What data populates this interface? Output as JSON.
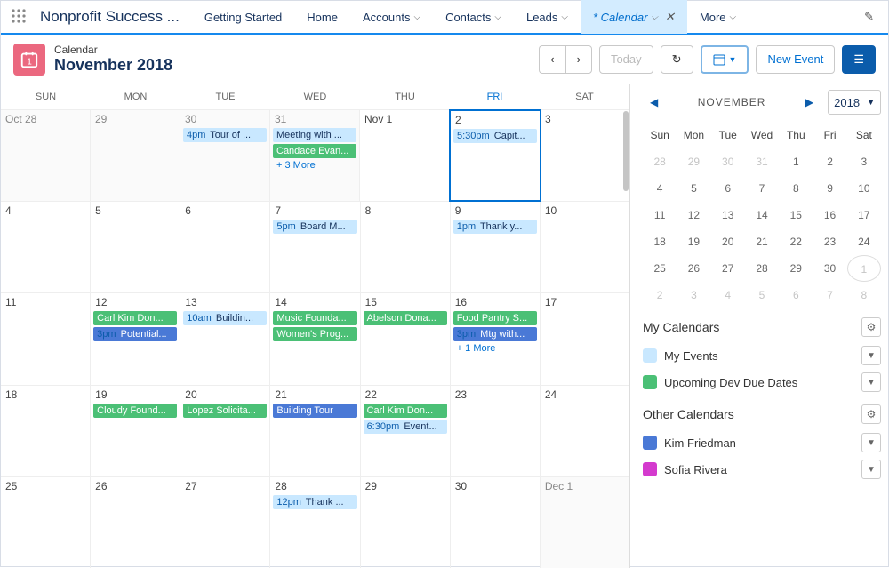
{
  "header": {
    "app_name": "Nonprofit Success ...",
    "tabs": [
      {
        "label": "Getting Started",
        "chev": false,
        "close": false
      },
      {
        "label": "Home",
        "chev": false,
        "close": false
      },
      {
        "label": "Accounts",
        "chev": true,
        "close": false
      },
      {
        "label": "Contacts",
        "chev": true,
        "close": false
      },
      {
        "label": "Leads",
        "chev": true,
        "close": false
      },
      {
        "label": "* Calendar",
        "chev": true,
        "close": true,
        "active": true
      },
      {
        "label": "More",
        "chev": true,
        "close": false
      }
    ]
  },
  "toolbar": {
    "subtitle": "Calendar",
    "title": "November 2018",
    "today": "Today",
    "new_event": "New Event"
  },
  "grid": {
    "dow": [
      "SUN",
      "MON",
      "TUE",
      "WED",
      "THU",
      "FRI",
      "SAT"
    ],
    "weeks": [
      [
        {
          "num": "Oct 28",
          "out": true,
          "events": []
        },
        {
          "num": "29",
          "out": true,
          "events": []
        },
        {
          "num": "30",
          "out": true,
          "events": [
            {
              "time": "4pm",
              "title": "Tour of ...",
              "cls": "lblue"
            }
          ]
        },
        {
          "num": "31",
          "out": true,
          "events": [
            {
              "title": "Meeting with ...",
              "cls": "lblue"
            },
            {
              "title": "Candace Evan...",
              "cls": "green"
            }
          ],
          "more": "+ 3 More"
        },
        {
          "num": "Nov 1",
          "events": []
        },
        {
          "num": "2",
          "selected": true,
          "events": [
            {
              "time": "5:30pm",
              "title": "Capit...",
              "cls": "lblue"
            }
          ]
        },
        {
          "num": "3",
          "events": []
        }
      ],
      [
        {
          "num": "4",
          "events": []
        },
        {
          "num": "5",
          "events": []
        },
        {
          "num": "6",
          "events": []
        },
        {
          "num": "7",
          "events": [
            {
              "time": "5pm",
              "title": "Board M...",
              "cls": "lblue"
            }
          ]
        },
        {
          "num": "8",
          "events": []
        },
        {
          "num": "9",
          "events": [
            {
              "time": "1pm",
              "title": "Thank y...",
              "cls": "lblue"
            }
          ]
        },
        {
          "num": "10",
          "events": []
        }
      ],
      [
        {
          "num": "11",
          "events": []
        },
        {
          "num": "12",
          "events": [
            {
              "title": "Carl Kim Don...",
              "cls": "green"
            },
            {
              "time": "3pm",
              "title": "Potential...",
              "cls": "nblue"
            }
          ]
        },
        {
          "num": "13",
          "events": [
            {
              "time": "10am",
              "title": "Buildin...",
              "cls": "lblue"
            }
          ]
        },
        {
          "num": "14",
          "events": [
            {
              "title": "Music Founda...",
              "cls": "green"
            },
            {
              "title": "Women's Prog...",
              "cls": "green"
            }
          ]
        },
        {
          "num": "15",
          "events": [
            {
              "title": "Abelson Dona...",
              "cls": "green"
            }
          ]
        },
        {
          "num": "16",
          "events": [
            {
              "title": "Food Pantry S...",
              "cls": "green"
            },
            {
              "time": "3pm",
              "title": "Mtg with...",
              "cls": "nblue"
            }
          ],
          "more": "+ 1 More"
        },
        {
          "num": "17",
          "events": []
        }
      ],
      [
        {
          "num": "18",
          "events": []
        },
        {
          "num": "19",
          "events": [
            {
              "title": "Cloudy Found...",
              "cls": "green"
            }
          ]
        },
        {
          "num": "20",
          "events": [
            {
              "title": "Lopez Solicita...",
              "cls": "green"
            }
          ]
        },
        {
          "num": "21",
          "events": [
            {
              "title": "Building Tour",
              "cls": "nblue"
            }
          ]
        },
        {
          "num": "22",
          "events": [
            {
              "title": "Carl Kim Don...",
              "cls": "green"
            },
            {
              "time": "6:30pm",
              "title": "Event...",
              "cls": "lblue"
            }
          ]
        },
        {
          "num": "23",
          "events": []
        },
        {
          "num": "24",
          "events": []
        }
      ],
      [
        {
          "num": "25",
          "events": []
        },
        {
          "num": "26",
          "events": []
        },
        {
          "num": "27",
          "events": []
        },
        {
          "num": "28",
          "events": [
            {
              "time": "12pm",
              "title": "Thank ...",
              "cls": "lblue"
            }
          ]
        },
        {
          "num": "29",
          "events": []
        },
        {
          "num": "30",
          "events": []
        },
        {
          "num": "Dec 1",
          "out": true,
          "events": []
        }
      ]
    ]
  },
  "mini": {
    "month": "NOVEMBER",
    "year": "2018",
    "dow": [
      "Sun",
      "Mon",
      "Tue",
      "Wed",
      "Thu",
      "Fri",
      "Sat"
    ],
    "rows": [
      [
        {
          "n": "28",
          "out": true
        },
        {
          "n": "29",
          "out": true
        },
        {
          "n": "30",
          "out": true
        },
        {
          "n": "31",
          "out": true
        },
        {
          "n": "1"
        },
        {
          "n": "2"
        },
        {
          "n": "3"
        }
      ],
      [
        {
          "n": "4"
        },
        {
          "n": "5"
        },
        {
          "n": "6"
        },
        {
          "n": "7"
        },
        {
          "n": "8"
        },
        {
          "n": "9"
        },
        {
          "n": "10"
        }
      ],
      [
        {
          "n": "11"
        },
        {
          "n": "12"
        },
        {
          "n": "13"
        },
        {
          "n": "14"
        },
        {
          "n": "15"
        },
        {
          "n": "16"
        },
        {
          "n": "17"
        }
      ],
      [
        {
          "n": "18"
        },
        {
          "n": "19"
        },
        {
          "n": "20"
        },
        {
          "n": "21"
        },
        {
          "n": "22"
        },
        {
          "n": "23"
        },
        {
          "n": "24"
        }
      ],
      [
        {
          "n": "25"
        },
        {
          "n": "26"
        },
        {
          "n": "27"
        },
        {
          "n": "28"
        },
        {
          "n": "29"
        },
        {
          "n": "30"
        },
        {
          "n": "1",
          "out": true,
          "cur": true
        }
      ],
      [
        {
          "n": "2",
          "out": true
        },
        {
          "n": "3",
          "out": true
        },
        {
          "n": "4",
          "out": true
        },
        {
          "n": "5",
          "out": true
        },
        {
          "n": "6",
          "out": true
        },
        {
          "n": "7",
          "out": true
        },
        {
          "n": "8",
          "out": true
        }
      ]
    ]
  },
  "side": {
    "my_title": "My Calendars",
    "my": [
      {
        "label": "My Events",
        "color": "lblue"
      },
      {
        "label": "Upcoming Dev Due Dates",
        "color": "green"
      }
    ],
    "other_title": "Other Calendars",
    "other": [
      {
        "label": "Kim Friedman",
        "color": "nblue"
      },
      {
        "label": "Sofia Rivera",
        "color": "mag"
      }
    ]
  }
}
